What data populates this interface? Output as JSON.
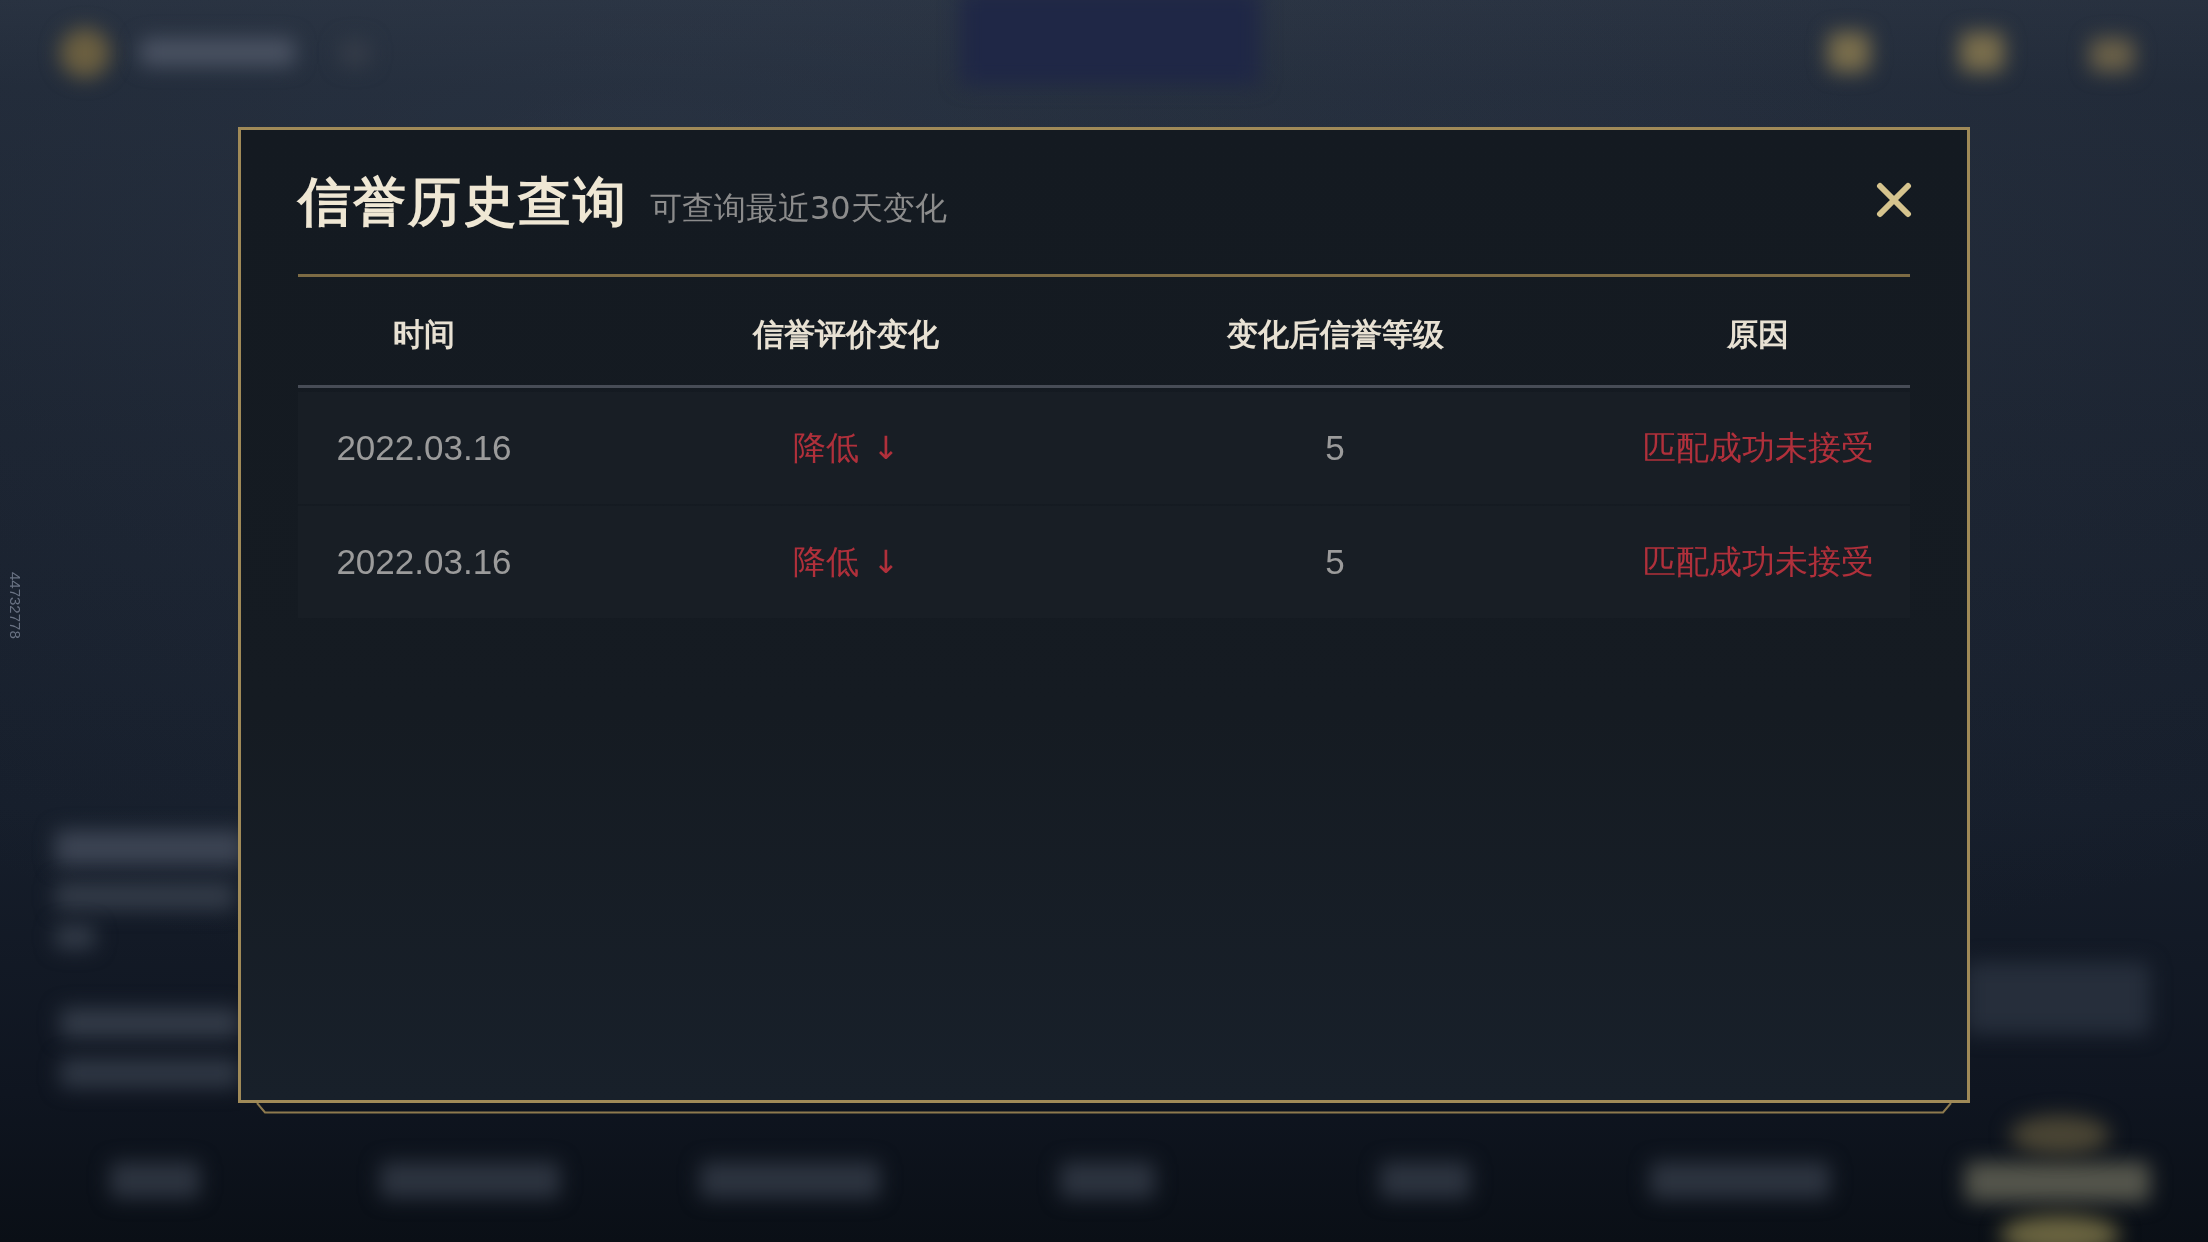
{
  "side_id": "44732778",
  "dialog": {
    "title": "信誉历史查询",
    "subtitle": "可查询最近30天变化",
    "table": {
      "columns": [
        "时间",
        "信誉评价变化",
        "变化后信誉等级",
        "原因"
      ],
      "rows": [
        {
          "time": "2022.03.16",
          "change": "降低",
          "change_arrow": "↓",
          "level_after": "5",
          "reason": "匹配成功未接受"
        },
        {
          "time": "2022.03.16",
          "change": "降低",
          "change_arrow": "↓",
          "level_after": "5",
          "reason": "匹配成功未接受"
        }
      ]
    }
  }
}
